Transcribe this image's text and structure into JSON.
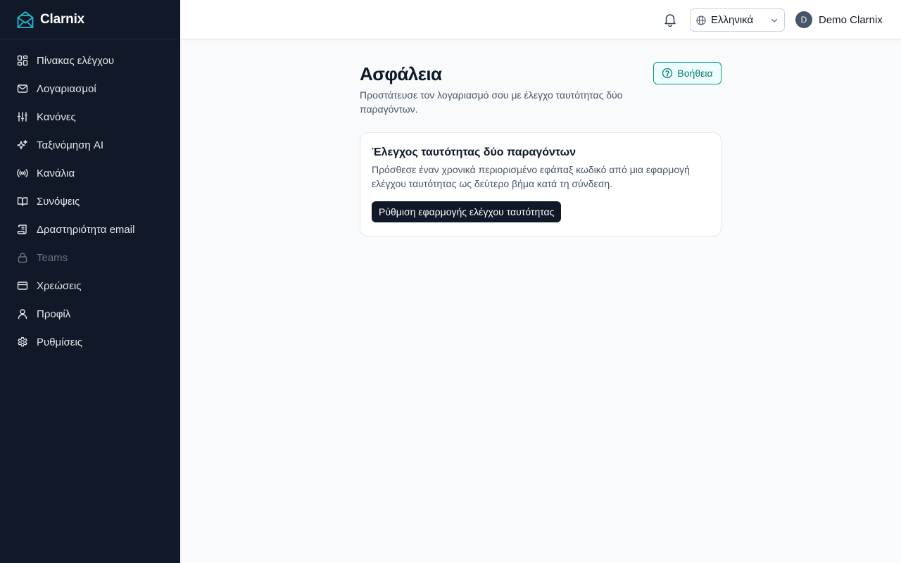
{
  "app": {
    "name": "Clarnix",
    "accent_color": "#22b8cf"
  },
  "sidebar": {
    "items": [
      {
        "label": "Πίνακας ελέγχου",
        "icon": "dashboard-icon"
      },
      {
        "label": "Λογαριασμοί",
        "icon": "mail-icon"
      },
      {
        "label": "Κανόνες",
        "icon": "sliders-icon"
      },
      {
        "label": "Ταξινόμηση AI",
        "icon": "sparkles-icon"
      },
      {
        "label": "Κανάλια",
        "icon": "radio-icon"
      },
      {
        "label": "Συνόψεις",
        "icon": "book-icon"
      },
      {
        "label": "Δραστηριότητα email",
        "icon": "scroll-icon"
      },
      {
        "label": "Teams",
        "icon": "lock-icon",
        "disabled": true
      },
      {
        "label": "Χρεώσεις",
        "icon": "credit-card-icon"
      },
      {
        "label": "Προφίλ",
        "icon": "user-icon"
      },
      {
        "label": "Ρυθμίσεις",
        "icon": "gear-icon"
      }
    ]
  },
  "header": {
    "language": "Ελληνικά",
    "user_initial": "D",
    "user_name": "Demo Clarnix"
  },
  "page": {
    "title": "Ασφάλεια",
    "subtitle": "Προστάτευσε τον λογαριασμό σου με έλεγχο ταυτότητας δύο παραγόντων.",
    "help_label": "Βοήθεια"
  },
  "two_factor_card": {
    "title": "Έλεγχος ταυτότητας δύο παραγόντων",
    "description": "Πρόσθεσε έναν χρονικά περιορισμένο εφάπαξ κωδικό από μια εφαρμογή ελέγχου ταυτότητας ως δεύτερο βήμα κατά τη σύνδεση.",
    "button_label": "Ρύθμιση εφαρμογής ελέγχου ταυτότητας"
  }
}
